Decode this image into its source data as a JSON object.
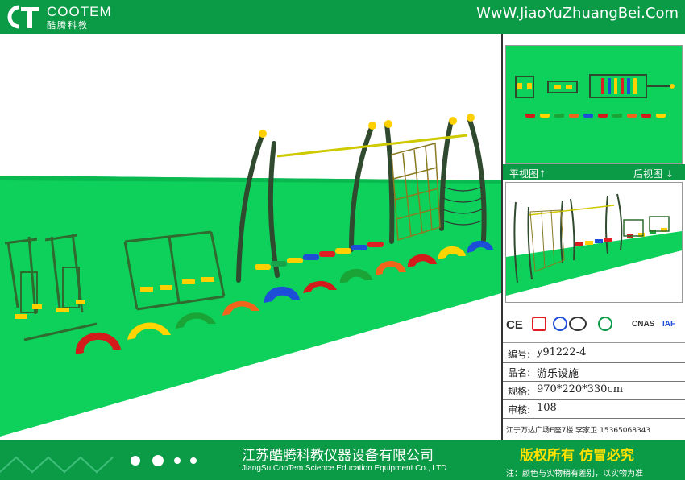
{
  "header": {
    "brand": "COOTEM",
    "brand_cn": "酷腾科教",
    "website": "WwW.JiaoYuZhuangBei.Com"
  },
  "panel": {
    "plan_label": "平视图",
    "back_label": "后视图",
    "certifications": [
      "CE",
      "CNAS",
      "IAF"
    ],
    "info": [
      {
        "key": "编号:",
        "value": "y91222-4"
      },
      {
        "key": "品名:",
        "value": "游乐设施"
      },
      {
        "key": "规格:",
        "value": "970*220*330cm"
      },
      {
        "key": "审核:",
        "value": "108"
      }
    ],
    "address": "江宁万达广场E座7楼 李家卫 15365068343"
  },
  "footer": {
    "company": "江苏酷腾科教仪器设备有限公司",
    "company_en": "JiangSu CooTem Science Education Equipment Co., LTD",
    "rights": "版权所有 仿冒必究",
    "note": "注：颜色与实物稍有差别，以实物为准"
  },
  "colors": {
    "brand_green": "#0b9a46",
    "grass": "#0dd15a",
    "accent_yellow": "#ffe100"
  }
}
